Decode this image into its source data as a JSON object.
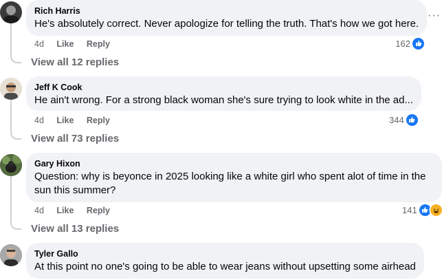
{
  "more_menu_label": "···",
  "comments": [
    {
      "author": "Rich Harris",
      "text": "He's absolutely correct. Never apologize for telling the truth. That's how we got here.",
      "time": "4d",
      "like_label": "Like",
      "reply_label": "Reply",
      "reaction_count": "162",
      "reaction_icons": [
        "like-icon"
      ],
      "view_replies": "View all 12 replies"
    },
    {
      "author": "Jeff K Cook",
      "text": "He ain't wrong. For a strong black woman she's sure trying to look white in the ad...",
      "time": "4d",
      "like_label": "Like",
      "reply_label": "Reply",
      "reaction_count": "344",
      "reaction_icons": [
        "like-icon"
      ],
      "view_replies": "View all 73 replies"
    },
    {
      "author": "Gary Hixon",
      "text_line1": "Question: why is beyonce in 2025 looking like a white girl who spent alot of time in the",
      "text_line2": "sun this summer?",
      "time": "4d",
      "like_label": "Like",
      "reply_label": "Reply",
      "reaction_count": "141",
      "reaction_icons": [
        "like-icon",
        "haha-icon"
      ],
      "view_replies": "View all 13 replies"
    },
    {
      "author": "Tyler Gallo",
      "text": "At this point no one's going to be able to wear jeans without upsetting some airhead"
    }
  ],
  "colors": {
    "bubble": "#f0f2f5",
    "secondary_text": "#65676b",
    "like_blue": "#1877f2",
    "thread_line": "#ced0d4"
  }
}
